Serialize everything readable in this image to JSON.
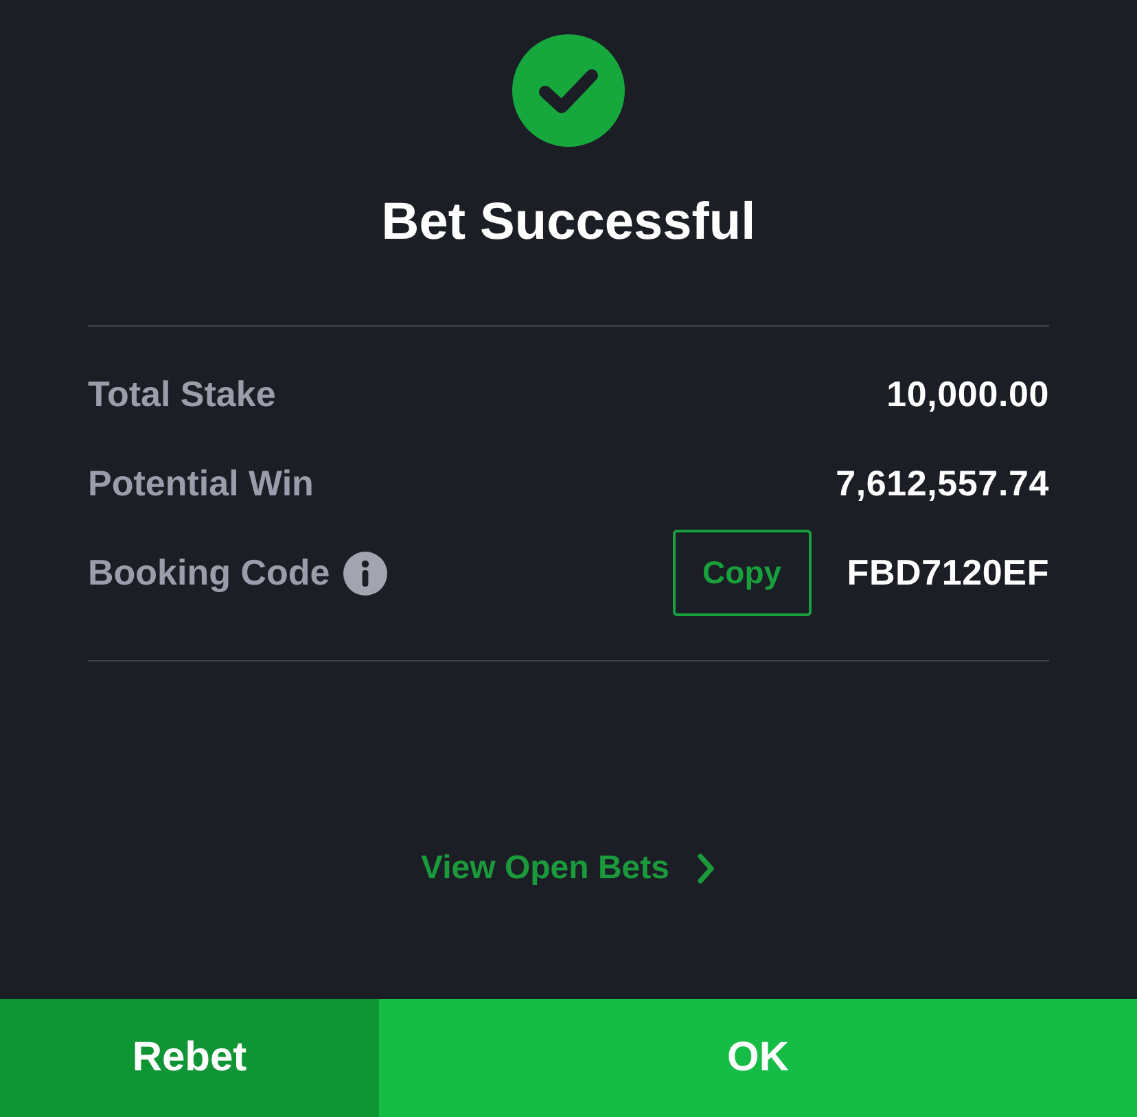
{
  "status": {
    "title": "Bet Successful"
  },
  "summary": [
    {
      "kind": "amount",
      "label": "Total Stake",
      "value": "10,000.00"
    },
    {
      "kind": "amount",
      "label": "Potential Win",
      "value": "7,612,557.74"
    },
    {
      "kind": "code",
      "label": "Booking Code",
      "value": "FBD7120EF",
      "action": "Copy"
    }
  ],
  "link": {
    "label": "View Open Bets"
  },
  "buttons": [
    {
      "kind": "secondary",
      "label": "Rebet"
    },
    {
      "kind": "primary",
      "label": "OK"
    }
  ]
}
